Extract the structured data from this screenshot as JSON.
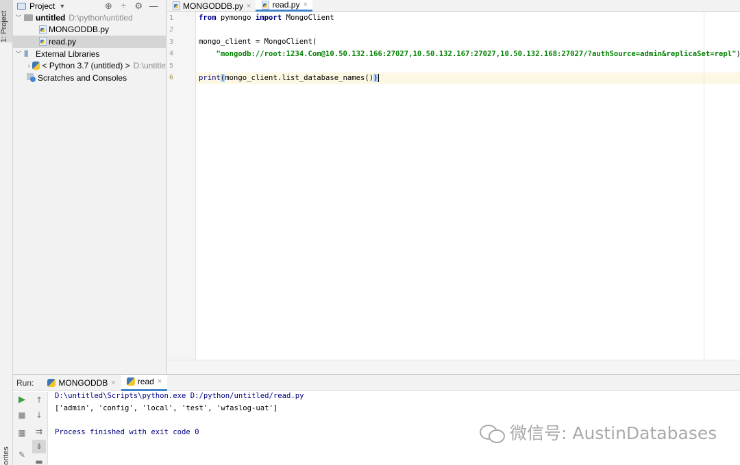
{
  "toolstrip": {
    "project_tab": "1: Project",
    "favorites_tab": "orites"
  },
  "project_panel": {
    "title": "Project",
    "icons": [
      "locate-icon",
      "collapse-icon",
      "settings-icon",
      "minimize-icon"
    ],
    "tree": {
      "root_name": "untitled",
      "root_path": "D:\\python\\untitled",
      "files": [
        "MONGODDB.py",
        "read.py"
      ],
      "external_libraries": "External Libraries",
      "python_sdk": "< Python 3.7 (untitled) >",
      "python_sdk_path": "D:\\untitle",
      "scratches": "Scratches and Consoles"
    }
  },
  "editor": {
    "tabs": [
      {
        "label": "MONGODDB.py",
        "active": false
      },
      {
        "label": "read.py",
        "active": true
      }
    ],
    "line_numbers": [
      "1",
      "2",
      "3",
      "4",
      "5",
      "6"
    ],
    "code": {
      "l1_kw1": "from",
      "l1_mod": " pymongo ",
      "l1_kw2": "import",
      "l1_name": " MongoClient",
      "l3": "mongo_client = MongoClient(",
      "l4_str": "\"mongodb://root:1234.Com@10.50.132.166:27027,10.50.132.167:27027,10.50.132.168:27027/?authSource=admin&replicaSet=repl\"",
      "l4_end": ")",
      "l6_fn": "print",
      "l6_open": "(",
      "l6_body": "mongo_client.list_database_names()",
      "l6_close": ")"
    }
  },
  "run_panel": {
    "label": "Run:",
    "tabs": [
      {
        "label": "MONGODDB",
        "active": false
      },
      {
        "label": "read",
        "active": true
      }
    ],
    "output": {
      "command": "D:\\untitled\\Scripts\\python.exe D:/python/untitled/read.py",
      "result": "['admin', 'config', 'local', 'test', 'wfaslog-uat']",
      "finished": "Process finished with exit code 0"
    }
  },
  "watermark": "微信号: AustinDatabases",
  "colors": {
    "accent": "#4083c9",
    "keyword": "#000080",
    "string": "#008000",
    "current_line": "#fcf8e4",
    "selection": "#d5d5d5",
    "run_green": "#3c9b3c"
  }
}
